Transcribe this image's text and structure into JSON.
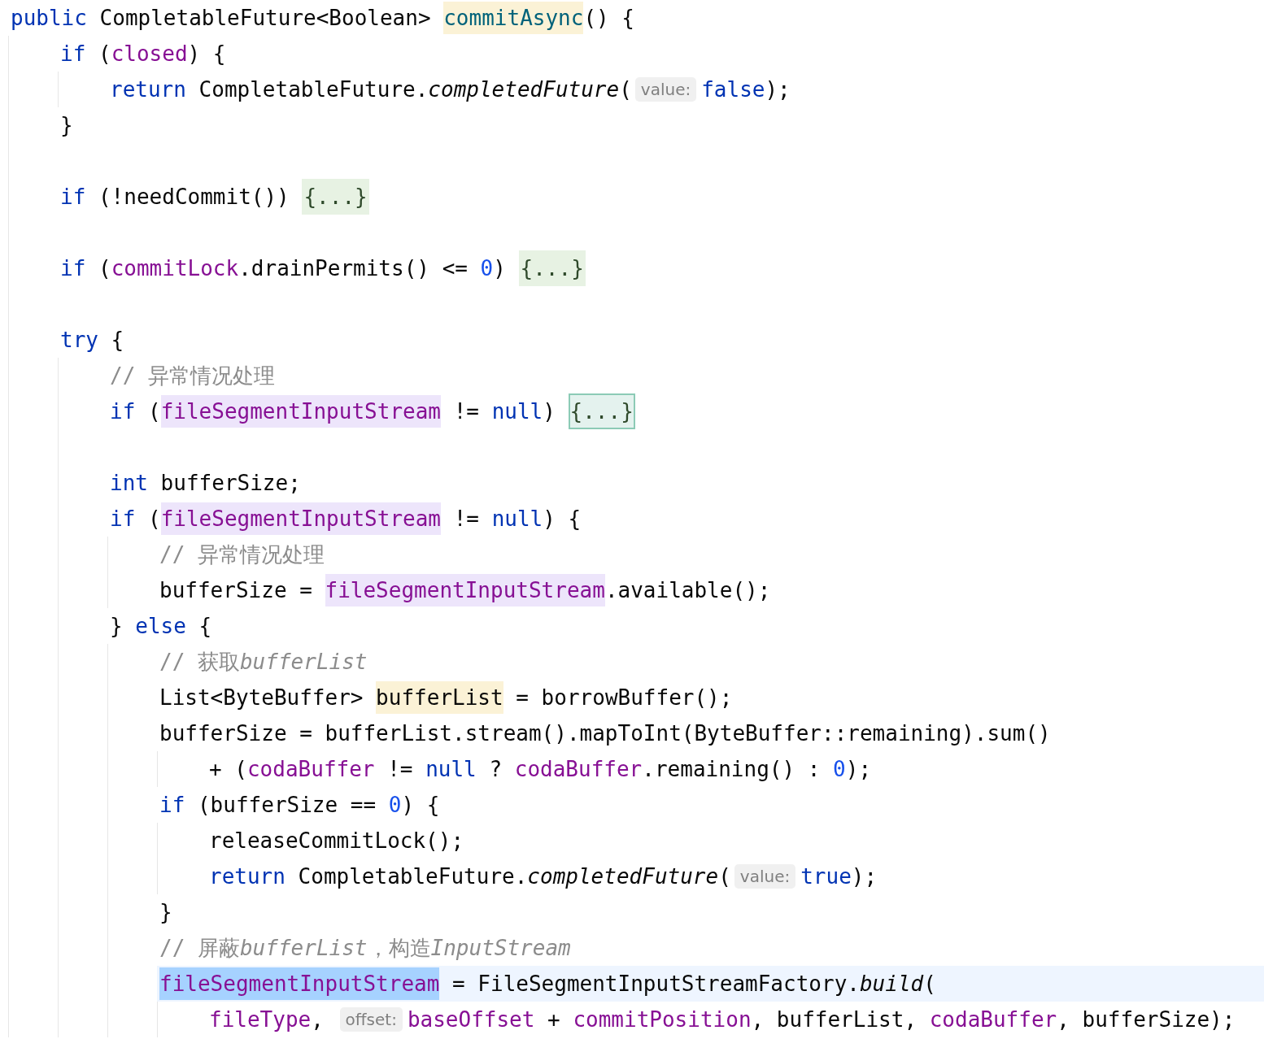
{
  "lines": [
    {
      "current": false,
      "tokens": [
        {
          "kind": "keyword",
          "text": "public"
        },
        {
          "kind": "plain",
          "text": " CompletableFuture<Boolean> "
        },
        {
          "kind": "declaration",
          "text": "commitAsync",
          "color": "#fbf2d6"
        },
        {
          "kind": "plain",
          "text": "() {"
        }
      ],
      "children": [
        {
          "current": false,
          "tokens": [
            {
              "kind": "keyword",
              "text": "if"
            },
            {
              "kind": "plain",
              "text": " ("
            },
            {
              "kind": "field",
              "text": "closed"
            },
            {
              "kind": "plain",
              "text": ") {"
            }
          ],
          "children": [
            {
              "current": false,
              "tokens": [
                {
                  "kind": "keyword",
                  "text": "return"
                },
                {
                  "kind": "plain",
                  "text": " CompletableFuture."
                },
                {
                  "kind": "italic",
                  "text": "completedFuture"
                },
                {
                  "kind": "plain",
                  "text": "("
                },
                {
                  "kind": "hint",
                  "text": "value:"
                },
                {
                  "kind": "keyword",
                  "text": "false"
                },
                {
                  "kind": "plain",
                  "text": ");"
                }
              ]
            }
          ]
        },
        {
          "current": false,
          "tokens": [
            {
              "kind": "plain",
              "text": "}"
            }
          ]
        },
        {
          "current": false
        },
        {
          "current": false,
          "tokens": [
            {
              "kind": "keyword",
              "text": "if"
            },
            {
              "kind": "plain",
              "text": " (!needCommit()) "
            },
            {
              "kind": "fold",
              "text": "{...}",
              "selected": false
            }
          ]
        },
        {
          "current": false
        },
        {
          "current": false,
          "tokens": [
            {
              "kind": "keyword",
              "text": "if"
            },
            {
              "kind": "plain",
              "text": " ("
            },
            {
              "kind": "field",
              "text": "commitLock"
            },
            {
              "kind": "plain",
              "text": ".drainPermits() <= "
            },
            {
              "kind": "number",
              "text": "0"
            },
            {
              "kind": "plain",
              "text": ") "
            },
            {
              "kind": "fold",
              "text": "{...}",
              "selected": false
            }
          ]
        },
        {
          "current": false
        },
        {
          "current": false,
          "tokens": [
            {
              "kind": "keyword",
              "text": "try"
            },
            {
              "kind": "plain",
              "text": " {"
            }
          ],
          "children": [
            {
              "current": false,
              "tokens": [
                {
                  "kind": "comment",
                  "text": "// 异常情况处理"
                }
              ]
            },
            {
              "current": false,
              "tokens": [
                {
                  "kind": "keyword",
                  "text": "if"
                },
                {
                  "kind": "plain",
                  "text": " ("
                },
                {
                  "kind": "field",
                  "text": "fileSegmentInputStream",
                  "color": "#ede5fb"
                },
                {
                  "kind": "plain",
                  "text": " != "
                },
                {
                  "kind": "keyword",
                  "text": "null"
                },
                {
                  "kind": "plain",
                  "text": ") "
                },
                {
                  "kind": "fold",
                  "text": "{...}",
                  "selected": true
                }
              ]
            },
            {
              "current": false
            },
            {
              "current": false,
              "tokens": [
                {
                  "kind": "keyword",
                  "text": "int"
                },
                {
                  "kind": "plain",
                  "text": " bufferSize;"
                }
              ]
            },
            {
              "current": false,
              "tokens": [
                {
                  "kind": "keyword",
                  "text": "if"
                },
                {
                  "kind": "plain",
                  "text": " ("
                },
                {
                  "kind": "field",
                  "text": "fileSegmentInputStream",
                  "color": "#ede5fb"
                },
                {
                  "kind": "plain",
                  "text": " != "
                },
                {
                  "kind": "keyword",
                  "text": "null"
                },
                {
                  "kind": "plain",
                  "text": ") {"
                }
              ],
              "children": [
                {
                  "current": false,
                  "tokens": [
                    {
                      "kind": "comment",
                      "text": "// 异常情况处理"
                    }
                  ]
                },
                {
                  "current": false,
                  "tokens": [
                    {
                      "kind": "plain",
                      "text": "bufferSize = "
                    },
                    {
                      "kind": "field",
                      "text": "fileSegmentInputStream",
                      "color": "#ede5fb"
                    },
                    {
                      "kind": "plain",
                      "text": ".available();"
                    }
                  ]
                }
              ]
            },
            {
              "current": false,
              "tokens": [
                {
                  "kind": "plain",
                  "text": "} "
                },
                {
                  "kind": "keyword",
                  "text": "else"
                },
                {
                  "kind": "plain",
                  "text": " {"
                }
              ],
              "children": [
                {
                  "current": false,
                  "tokens": [
                    {
                      "kind": "comment",
                      "text": "// 获取"
                    },
                    {
                      "kind": "comment_italic",
                      "text": "bufferList"
                    }
                  ]
                },
                {
                  "current": false,
                  "tokens": [
                    {
                      "kind": "plain",
                      "text": "List<ByteBuffer> "
                    },
                    {
                      "kind": "plain",
                      "text": "bufferList",
                      "color": "#fbf2d6"
                    },
                    {
                      "kind": "plain",
                      "text": " = borrowBuffer();"
                    }
                  ]
                },
                {
                  "current": false,
                  "tokens": [
                    {
                      "kind": "plain",
                      "text": "bufferSize = bufferList.stream().mapToInt(ByteBuffer::remaining).sum()"
                    }
                  ],
                  "children": [
                    {
                      "current": false,
                      "tokens": [
                        {
                          "kind": "plain",
                          "text": "+ ("
                        },
                        {
                          "kind": "field",
                          "text": "codaBuffer"
                        },
                        {
                          "kind": "plain",
                          "text": " != "
                        },
                        {
                          "kind": "keyword",
                          "text": "null"
                        },
                        {
                          "kind": "plain",
                          "text": " ? "
                        },
                        {
                          "kind": "field",
                          "text": "codaBuffer"
                        },
                        {
                          "kind": "plain",
                          "text": ".remaining() : "
                        },
                        {
                          "kind": "number",
                          "text": "0"
                        },
                        {
                          "kind": "plain",
                          "text": ");"
                        }
                      ]
                    }
                  ]
                },
                {
                  "current": false,
                  "tokens": [
                    {
                      "kind": "keyword",
                      "text": "if"
                    },
                    {
                      "kind": "plain",
                      "text": " (bufferSize == "
                    },
                    {
                      "kind": "number",
                      "text": "0"
                    },
                    {
                      "kind": "plain",
                      "text": ") {"
                    }
                  ],
                  "children": [
                    {
                      "current": false,
                      "tokens": [
                        {
                          "kind": "plain",
                          "text": "releaseCommitLock();"
                        }
                      ]
                    },
                    {
                      "current": false,
                      "tokens": [
                        {
                          "kind": "keyword",
                          "text": "return"
                        },
                        {
                          "kind": "plain",
                          "text": " CompletableFuture."
                        },
                        {
                          "kind": "italic",
                          "text": "completedFuture"
                        },
                        {
                          "kind": "plain",
                          "text": "("
                        },
                        {
                          "kind": "hint",
                          "text": "value:"
                        },
                        {
                          "kind": "keyword",
                          "text": "true"
                        },
                        {
                          "kind": "plain",
                          "text": ");"
                        }
                      ]
                    }
                  ]
                },
                {
                  "current": false,
                  "tokens": [
                    {
                      "kind": "plain",
                      "text": "}"
                    }
                  ]
                },
                {
                  "current": false,
                  "tokens": [
                    {
                      "kind": "comment",
                      "text": "// 屏蔽"
                    },
                    {
                      "kind": "comment_italic",
                      "text": "bufferList"
                    },
                    {
                      "kind": "comment",
                      "text": "，构造"
                    },
                    {
                      "kind": "comment_italic",
                      "text": "InputStream"
                    }
                  ]
                },
                {
                  "current": true,
                  "tokens": [
                    {
                      "kind": "field",
                      "text": "fileSegmentInputStream",
                      "color": "#a6d2ff"
                    },
                    {
                      "kind": "plain",
                      "text": " = FileSegmentInputStreamFactory."
                    },
                    {
                      "kind": "italic",
                      "text": "build"
                    },
                    {
                      "kind": "plain",
                      "text": "("
                    }
                  ],
                  "children": [
                    {
                      "current": false,
                      "tokens": [
                        {
                          "kind": "field",
                          "text": "fileType"
                        },
                        {
                          "kind": "plain",
                          "text": ", "
                        },
                        {
                          "kind": "hint",
                          "text": "offset:"
                        },
                        {
                          "kind": "field",
                          "text": "baseOffset"
                        },
                        {
                          "kind": "plain",
                          "text": " + "
                        },
                        {
                          "kind": "field",
                          "text": "commitPosition"
                        },
                        {
                          "kind": "plain",
                          "text": ", bufferList, "
                        },
                        {
                          "kind": "field",
                          "text": "codaBuffer"
                        },
                        {
                          "kind": "plain",
                          "text": ", bufferSize);"
                        }
                      ]
                    }
                  ]
                }
              ]
            }
          ]
        }
      ]
    }
  ]
}
